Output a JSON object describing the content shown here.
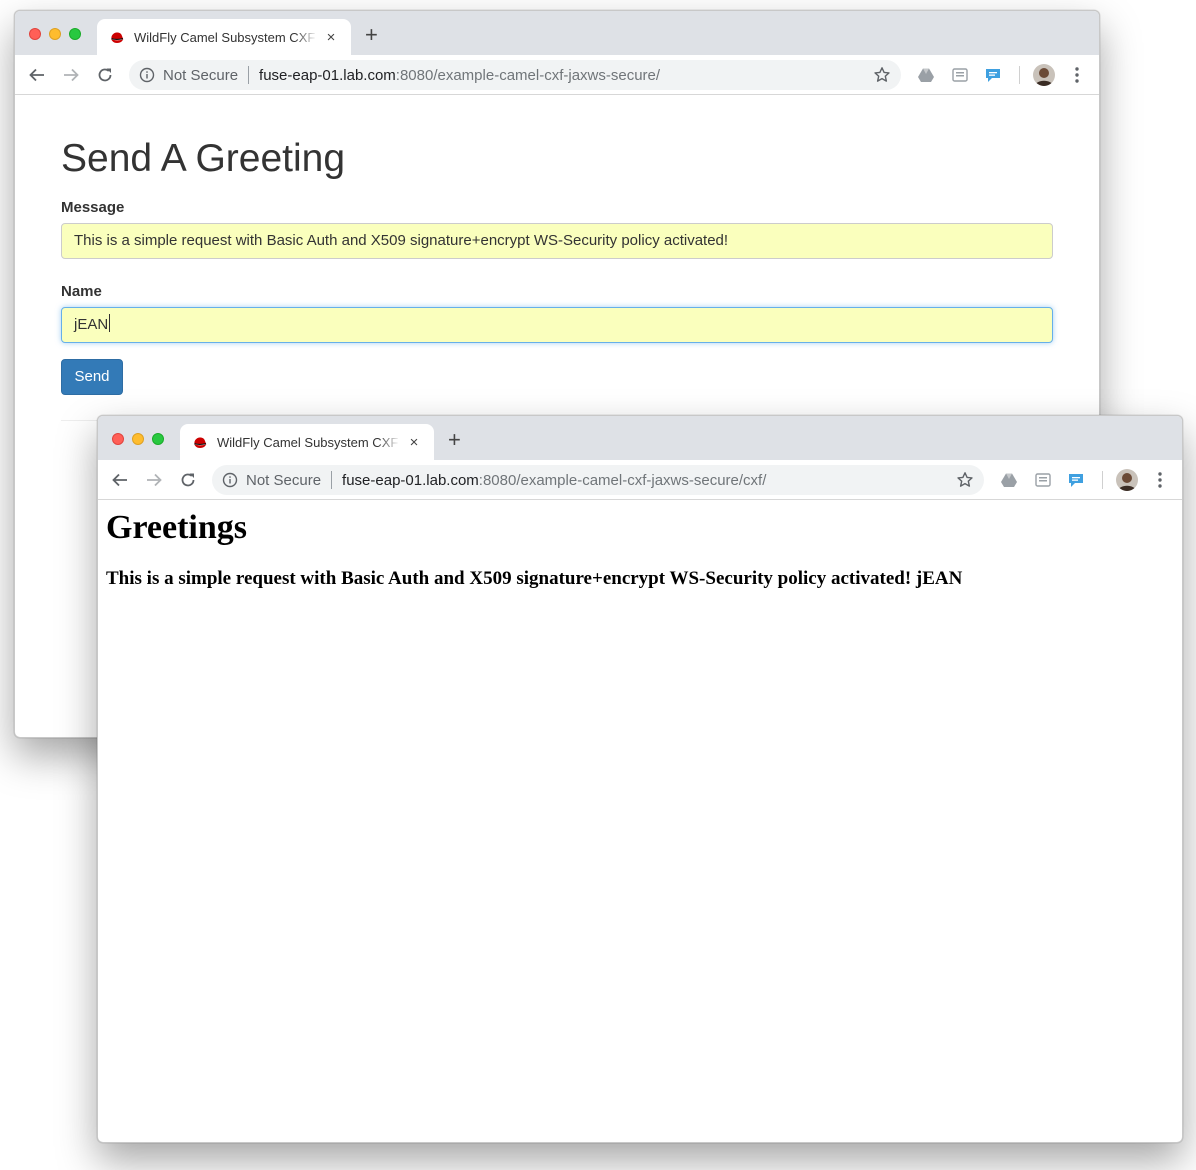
{
  "back_window": {
    "tab": {
      "title": "WildFly Camel Subsystem CXF",
      "close": "×",
      "new_tab": "+"
    },
    "address": {
      "security_label": "Not Secure",
      "host": "fuse-eap-01.lab.com",
      "path": ":8080/example-camel-cxf-jaxws-secure/"
    },
    "page": {
      "title": "Send A Greeting",
      "message_label": "Message",
      "message_value": "This is a simple request with Basic Auth and X509 signature+encrypt WS-Security policy activated!",
      "name_label": "Name",
      "name_value": "jEAN",
      "send_label": "Send",
      "autofill_color": "#faffbd",
      "button_color": "#337ab7"
    }
  },
  "front_window": {
    "tab": {
      "title": "WildFly Camel Subsystem CXF",
      "close": "×",
      "new_tab": "+"
    },
    "address": {
      "security_label": "Not Secure",
      "host": "fuse-eap-01.lab.com",
      "path": ":8080/example-camel-cxf-jaxws-secure/cxf/"
    },
    "page": {
      "heading": "Greetings",
      "result": "This is a simple request with Basic Auth and X509 signature+encrypt WS-Security policy activated! jEAN"
    }
  },
  "toolbar_icons": [
    "back-arrow-icon",
    "forward-arrow-icon",
    "reload-icon",
    "info-icon",
    "star-icon",
    "google-drive-icon",
    "reader-icon",
    "chat-extension-icon",
    "profile-avatar",
    "menu-dots-icon"
  ]
}
